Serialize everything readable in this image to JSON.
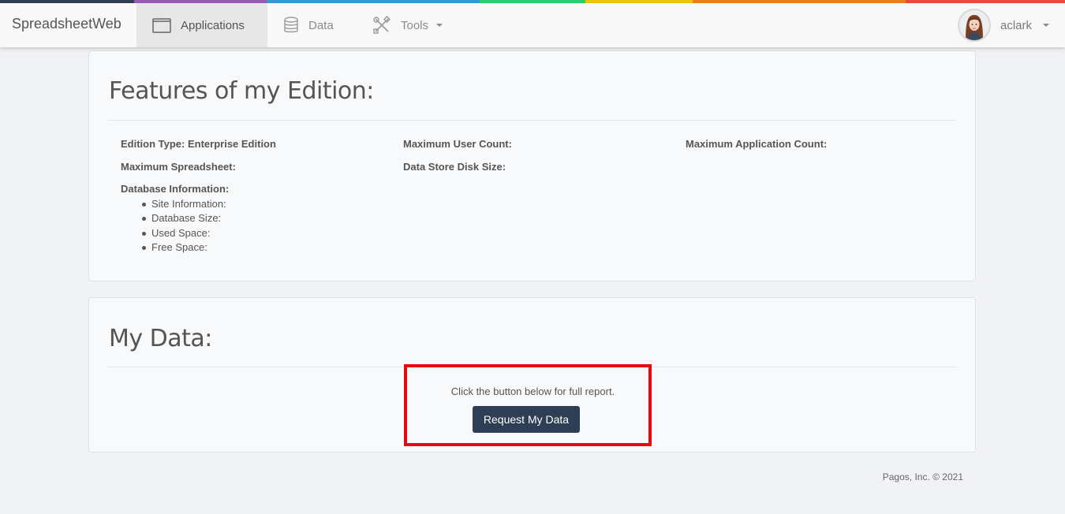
{
  "colors": {
    "rainbow": [
      "#2f3e54",
      "#9b59b6",
      "#3498db",
      "#2ecc71",
      "#f1c40f",
      "#e67e22",
      "#e74c3c"
    ],
    "button_bg": "#2e3e54",
    "highlight": "#e8090d"
  },
  "navbar": {
    "brand": "SpreadsheetWeb",
    "items": [
      {
        "label": "Applications",
        "icon": "window-icon"
      },
      {
        "label": "Data",
        "icon": "database-icon"
      },
      {
        "label": "Tools",
        "icon": "tools-icon"
      }
    ],
    "user": {
      "name": "aclark"
    }
  },
  "features": {
    "title": "Features of my Edition:",
    "edition_type": "Edition Type: Enterprise Edition",
    "max_user_count": "Maximum User Count:",
    "max_app_count": "Maximum Application Count:",
    "max_spreadsheet": "Maximum Spreadsheet:",
    "data_store_disk_size": "Data Store Disk Size:",
    "database_information": "Database Information:",
    "db_items": [
      "Site Information:",
      "Database Size:",
      "Used Space:",
      "Free Space:"
    ]
  },
  "my_data": {
    "title": "My Data:",
    "instruction": "Click the button below for full report.",
    "button_label": "Request My Data"
  },
  "footer": {
    "copyright": "Pagos, Inc. © 2021"
  }
}
